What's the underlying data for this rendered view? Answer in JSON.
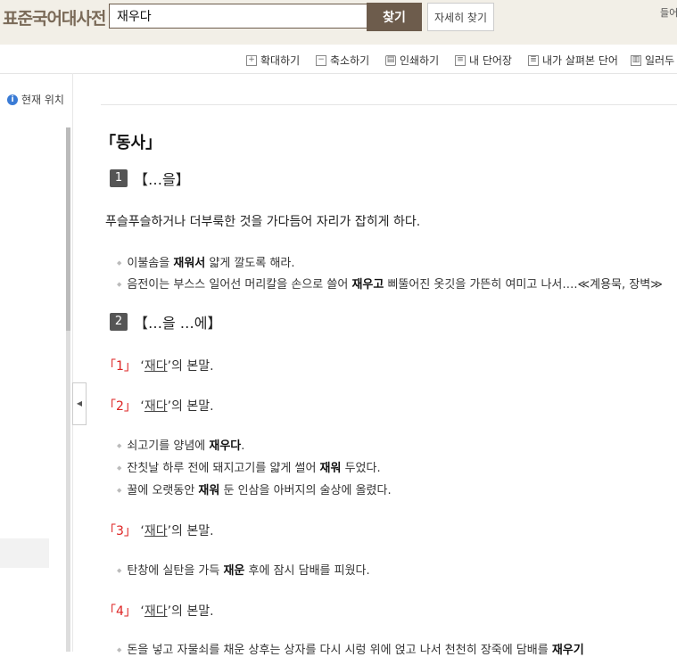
{
  "header": {
    "logo": "표준국어대사전",
    "search_value": "재우다",
    "search_button": "찾기",
    "detail_button": "자세히 찾기",
    "login": "들어"
  },
  "toolbar": {
    "zoom_in": "확대하기",
    "zoom_out": "축소하기",
    "print": "인쇄하기",
    "my_words": "내 단어장",
    "viewed_words": "내가 살펴본 단어",
    "report": "일러두"
  },
  "sidebar": {
    "location": "현재 위치"
  },
  "entry": {
    "pos": "「동사」",
    "senses": [
      {
        "num": "1",
        "pattern": "【…을】",
        "definition": "푸슬푸슬하거나 더부룩한 것을 가다듬어 자리가 잡히게 하다.",
        "examples": [
          {
            "pre": "이불솜을 ",
            "bold": "재워서",
            "post": " 얇게 깔도록 해라."
          },
          {
            "pre": "음전이는 부스스 일어선 머리칼을 손으로 쓸어 ",
            "bold": "재우고",
            "post": " 삐뚤어진 옷깃을 가뜬히 여미고 나서….≪계용묵, 장벽≫"
          }
        ]
      },
      {
        "num": "2",
        "pattern": "【…을 …에】",
        "subsenses": [
          {
            "num": "「1」",
            "ref": "재다",
            "tail": "’의 본말.",
            "examples": []
          },
          {
            "num": "「2」",
            "ref": "재다",
            "tail": "’의 본말.",
            "examples": [
              {
                "pre": "쇠고기를 양념에 ",
                "bold": "재우다",
                "post": "."
              },
              {
                "pre": "잔칫날 하루 전에 돼지고기를 얇게 썰어 ",
                "bold": "재워",
                "post": " 두었다."
              },
              {
                "pre": "꿀에 오랫동안 ",
                "bold": "재워",
                "post": " 둔 인삼을 아버지의 술상에 올렸다."
              }
            ]
          },
          {
            "num": "「3」",
            "ref": "재다",
            "tail": "’의 본말.",
            "examples": [
              {
                "pre": "탄창에 실탄을 가득 ",
                "bold": "재운",
                "post": " 후에 잠시 담배를 피웠다."
              }
            ]
          },
          {
            "num": "「4」",
            "ref": "재다",
            "tail": "’의 본말.",
            "examples": [
              {
                "pre": "돈을 넣고 자물쇠를 채운 상후는 상자를 다시 시렁 위에 얹고 나서 천천히 장죽에 담배를 ",
                "bold": "재우기",
                "post": ""
              }
            ]
          }
        ]
      }
    ]
  }
}
